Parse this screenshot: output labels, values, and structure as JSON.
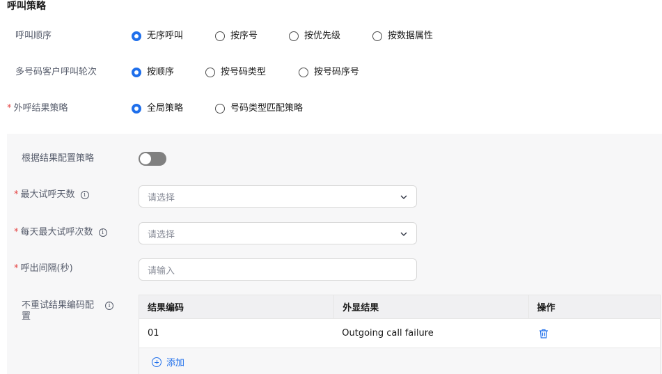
{
  "section_title": "呼叫策略",
  "call_order": {
    "label": "呼叫顺序",
    "options": [
      "无序呼叫",
      "按序号",
      "按优先级",
      "按数据属性"
    ],
    "selected": 0
  },
  "multi_number_rounds": {
    "label": "多号码客户呼叫轮次",
    "options": [
      "按顺序",
      "按号码类型",
      "按号码序号"
    ],
    "selected": 0
  },
  "outbound_result_strategy": {
    "required_mark": "*",
    "label": "外呼结果策略",
    "options": [
      "全局策略",
      "号码类型匹配策略"
    ],
    "selected": 0
  },
  "config_by_result": {
    "label": "根据结果配置策略",
    "enabled": false
  },
  "max_attempt_days": {
    "required_mark": "*",
    "label": "最大试呼天数",
    "placeholder": "请选择"
  },
  "max_daily_attempts": {
    "required_mark": "*",
    "label": "每天最大试呼次数",
    "placeholder": "请选择"
  },
  "call_interval": {
    "required_mark": "*",
    "label": "呼出间隔(秒)",
    "placeholder": "请输入"
  },
  "no_retry_codes": {
    "label_line1": "不重试结果编码配",
    "label_line2": "置",
    "info_glyph": "i",
    "columns": [
      "结果编码",
      "外显结果",
      "操作"
    ],
    "rows": [
      {
        "code": "01",
        "display": "Outgoing call failure"
      }
    ],
    "add_label": "添加"
  },
  "colors": {
    "accent": "#1f6feb",
    "required": "#e54545",
    "panel_bg": "#f7f7f8"
  },
  "icons": [
    "info-icon",
    "chevron-down-icon",
    "trash-icon",
    "plus-circle-icon"
  ]
}
